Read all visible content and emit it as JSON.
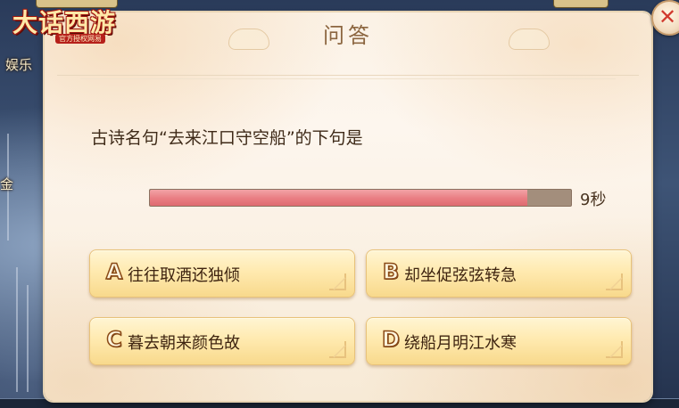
{
  "game": {
    "logo_title": "大话西游",
    "logo_subtitle": "官方授权网易",
    "background_labels": [
      "娱乐",
      "金"
    ]
  },
  "dialog": {
    "title": "问答",
    "question": "古诗名句“去来江口守空船”的下句是",
    "timer": {
      "remaining_text": "9秒",
      "remaining_fraction": 0.897
    },
    "options": [
      {
        "letter": "A",
        "text": "往往取酒还独倾"
      },
      {
        "letter": "B",
        "text": "却坐促弦弦转急"
      },
      {
        "letter": "C",
        "text": "暮去朝来颜色故"
      },
      {
        "letter": "D",
        "text": "绕船月明江水寒"
      }
    ],
    "close_icon": "close-icon"
  },
  "colors": {
    "timer_fill": "#e97d82",
    "timer_track": "#a38e7c",
    "option_bg": "#ffeab0",
    "title_text": "#8c6640",
    "close_x": "#d13a2e"
  }
}
